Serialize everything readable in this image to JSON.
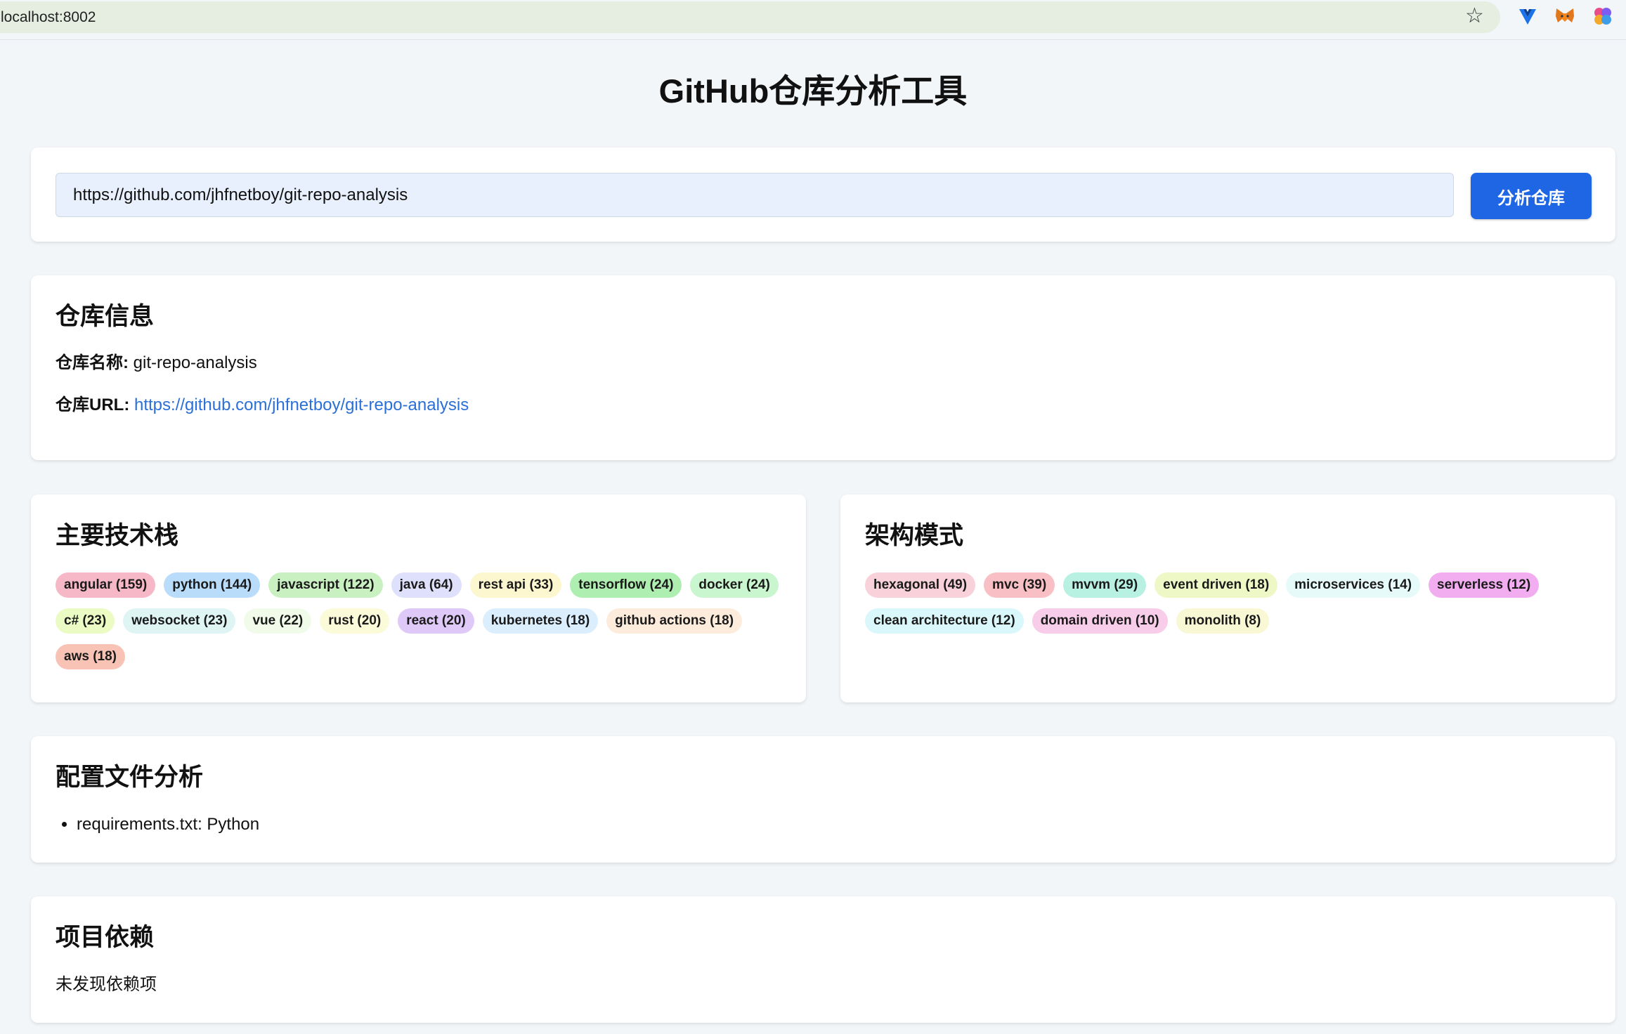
{
  "browser": {
    "url": "localhost:8002",
    "extensions": [
      "vue-devtools-icon",
      "metamask-icon",
      "extension-icon"
    ]
  },
  "page": {
    "title": "GitHub仓库分析工具"
  },
  "search": {
    "value": "https://github.com/jhfnetboy/git-repo-analysis",
    "button_label": "分析仓库"
  },
  "repo_info": {
    "heading": "仓库信息",
    "name_label": "仓库名称:",
    "name_value": "git-repo-analysis",
    "url_label": "仓库URL:",
    "url_value": "https://github.com/jhfnetboy/git-repo-analysis"
  },
  "tech_stack": {
    "heading": "主要技术栈",
    "tags": [
      {
        "label": "angular (159)",
        "color": "#f6b8c6"
      },
      {
        "label": "python (144)",
        "color": "#b9dcfb"
      },
      {
        "label": "javascript (122)",
        "color": "#c9f0c0"
      },
      {
        "label": "java (64)",
        "color": "#dfe0fb"
      },
      {
        "label": "rest api (33)",
        "color": "#fdf7cf"
      },
      {
        "label": "tensorflow (24)",
        "color": "#aeeeb0"
      },
      {
        "label": "docker (24)",
        "color": "#c9f5cf"
      },
      {
        "label": "c# (23)",
        "color": "#eafbc4"
      },
      {
        "label": "websocket (23)",
        "color": "#dff5f4"
      },
      {
        "label": "vue (22)",
        "color": "#f1fbe9"
      },
      {
        "label": "rust (20)",
        "color": "#fbfbd9"
      },
      {
        "label": "react (20)",
        "color": "#dec9f8"
      },
      {
        "label": "kubernetes (18)",
        "color": "#daeefd"
      },
      {
        "label": "github actions (18)",
        "color": "#fdebdc"
      },
      {
        "label": "aws (18)",
        "color": "#f8c3b5"
      }
    ]
  },
  "architecture": {
    "heading": "架构模式",
    "tags": [
      {
        "label": "hexagonal (49)",
        "color": "#f9d1da"
      },
      {
        "label": "mvc (39)",
        "color": "#f8c0c4"
      },
      {
        "label": "mvvm (29)",
        "color": "#b8f1e1"
      },
      {
        "label": "event driven (18)",
        "color": "#eef8c6"
      },
      {
        "label": "microservices (14)",
        "color": "#e6fbf9"
      },
      {
        "label": "serverless (12)",
        "color": "#f2adf0"
      },
      {
        "label": "clean architecture (12)",
        "color": "#daf7fb"
      },
      {
        "label": "domain driven (10)",
        "color": "#f8cdea"
      },
      {
        "label": "monolith (8)",
        "color": "#f8f8d4"
      }
    ]
  },
  "config": {
    "heading": "配置文件分析",
    "items": [
      "requirements.txt: Python"
    ]
  },
  "dependencies": {
    "heading": "项目依赖",
    "empty_text": "未发现依赖项"
  }
}
